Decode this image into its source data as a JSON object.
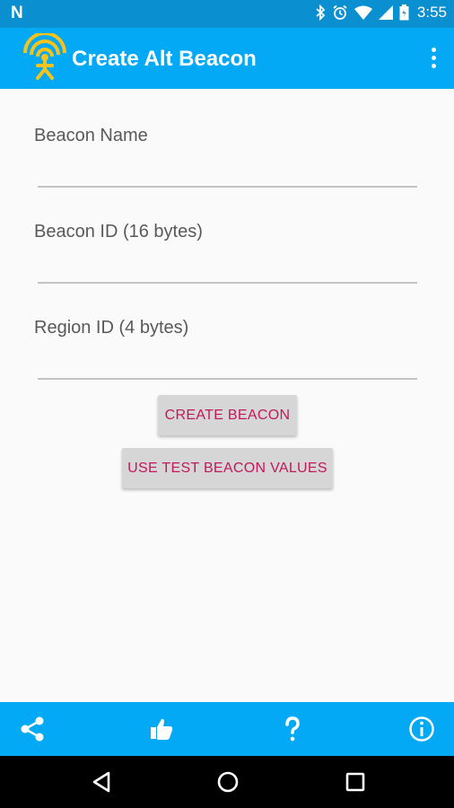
{
  "status_bar": {
    "time": "3:55",
    "icons": [
      "n-notification-icon",
      "bluetooth-icon",
      "alarm-icon",
      "wifi-icon",
      "signal-icon",
      "battery-icon"
    ]
  },
  "app_bar": {
    "title": "Create Alt Beacon",
    "icons": [
      "beacon-logo-icon",
      "overflow-menu-icon"
    ]
  },
  "form": {
    "beacon_name": {
      "label": "Beacon Name",
      "value": ""
    },
    "beacon_id": {
      "label": "Beacon ID (16 bytes)",
      "value": ""
    },
    "region_id": {
      "label": "Region ID (4 bytes)",
      "value": ""
    }
  },
  "buttons": {
    "create": "CREATE BEACON",
    "test_values": "USE TEST BEACON VALUES"
  },
  "bottom_bar": {
    "icons": [
      "share-icon",
      "thumbs-up-icon",
      "help-icon",
      "info-icon"
    ]
  },
  "nav_bar": {
    "icons": [
      "back-icon",
      "home-icon",
      "recents-icon"
    ]
  },
  "colors": {
    "status_bar": "#0a8fd1",
    "app_bar": "#03a9f4",
    "logo": "#f6c21c",
    "button_text": "#c2185b",
    "button_bg": "#d6d6d6"
  }
}
